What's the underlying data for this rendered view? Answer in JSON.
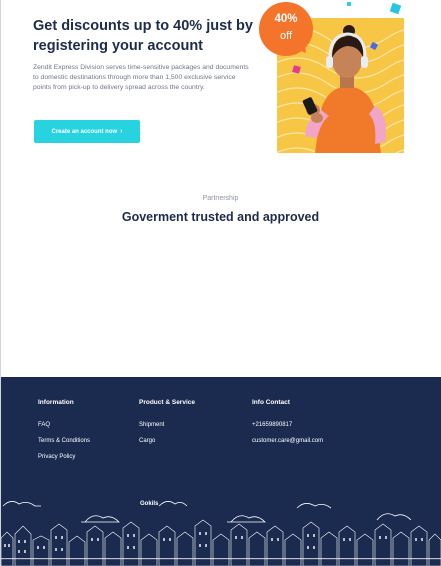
{
  "hero": {
    "title": "Get discounts up to 40% just by registering your account",
    "description": "Zendit Express Division serves time-sensitive packages and documents to domestic destinations through more than 1,500 exclusive service points from pick-up to delivery spread across the country.",
    "cta_label": "Create an account now",
    "cta_icon": "chevron-right-icon",
    "badge_percent": "40%",
    "badge_off": "off"
  },
  "partnership": {
    "eyebrow": "Partnership",
    "title": "Goverment trusted and approved"
  },
  "footer": {
    "columns": [
      {
        "heading": "Information",
        "links": [
          "FAQ",
          "Terms & Conditions",
          "Privacy Policy"
        ]
      },
      {
        "heading": "Product & Service",
        "links": [
          "Shipment",
          "Cargo"
        ]
      },
      {
        "heading": "Info Contact",
        "links": [
          "+21659890817",
          "customer.care@gmail.com"
        ]
      }
    ],
    "brand": "Gokils"
  },
  "colors": {
    "accent": "#27d3df",
    "heading": "#1e2b4a",
    "footer_bg": "#1b2b50",
    "badge": "#f4742b",
    "image_bg": "#f6c644"
  }
}
